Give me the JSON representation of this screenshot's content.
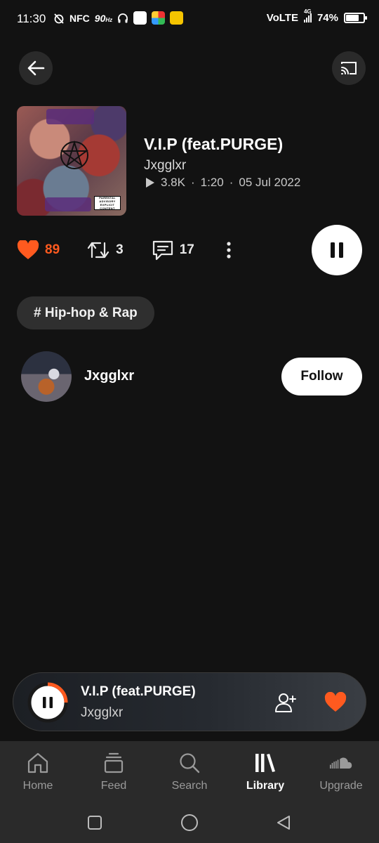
{
  "status_bar": {
    "time": "11:30",
    "nfc": "NFC",
    "refresh": "90",
    "refresh_unit": "Hz",
    "network": "VoLTE",
    "network_gen": "4G",
    "battery": "74%",
    "battery_level": 0.74
  },
  "track": {
    "title": "V.I.P (feat.PURGE)",
    "artist": "Jxgglxr",
    "plays": "3.8K",
    "duration": "1:20",
    "date": "05 Jul 2022",
    "advisory_text": "PARENTAL ADVISORY EXPLICIT CONTENT"
  },
  "actions": {
    "likes": "89",
    "reposts": "3",
    "comments": "17"
  },
  "genre": "# Hip-hop & Rap",
  "artist_row": {
    "name": "Jxgglxr",
    "follow_label": "Follow"
  },
  "mini_player": {
    "title": "V.I.P (feat.PURGE)",
    "artist": "Jxgglxr",
    "progress": 0.25
  },
  "nav": {
    "items": [
      {
        "label": "Home",
        "icon": "home-icon"
      },
      {
        "label": "Feed",
        "icon": "feed-icon"
      },
      {
        "label": "Search",
        "icon": "search-icon"
      },
      {
        "label": "Library",
        "icon": "library-icon"
      },
      {
        "label": "Upgrade",
        "icon": "soundcloud-icon"
      }
    ],
    "active": "Library"
  },
  "colors": {
    "accent": "#ff5a1f",
    "background": "#121212",
    "nav_bg": "#2a2a2a"
  }
}
